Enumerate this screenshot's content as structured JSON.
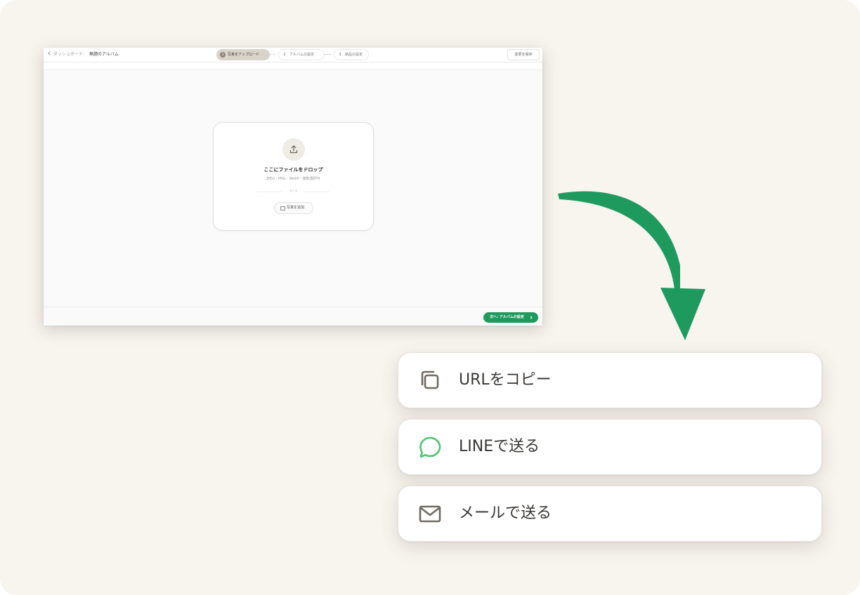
{
  "window": {
    "breadcrumb": {
      "back_label": "ダッシュボード",
      "separator": "/",
      "current": "無題のアルバム"
    },
    "steps": [
      {
        "num": "1",
        "label": "写真をアップロード",
        "state": "active"
      },
      {
        "num": "2",
        "label": "アルバムの設定",
        "state": "inactive"
      },
      {
        "num": "3",
        "label": "納品の設定",
        "state": "inactive"
      }
    ],
    "save_label": "変更を保存",
    "dropzone": {
      "title": "ここにファイルをドロップ",
      "formats": "JPEG・PNG・WebP・複数選択可",
      "or": "または",
      "add_button": "写真を追加"
    },
    "next_button": "次へ: アルバムの設定"
  },
  "share_options": [
    {
      "label": "URLをコピー",
      "icon": "copy-icon"
    },
    {
      "label": "LINEで送る",
      "icon": "chat-bubble-icon"
    },
    {
      "label": "メールで送る",
      "icon": "mail-icon"
    }
  ],
  "colors": {
    "background": "#f8f4ee",
    "accent_green": "#1f9a5f",
    "line_green": "#4cc56e",
    "active_step": "#d9d3ca"
  }
}
